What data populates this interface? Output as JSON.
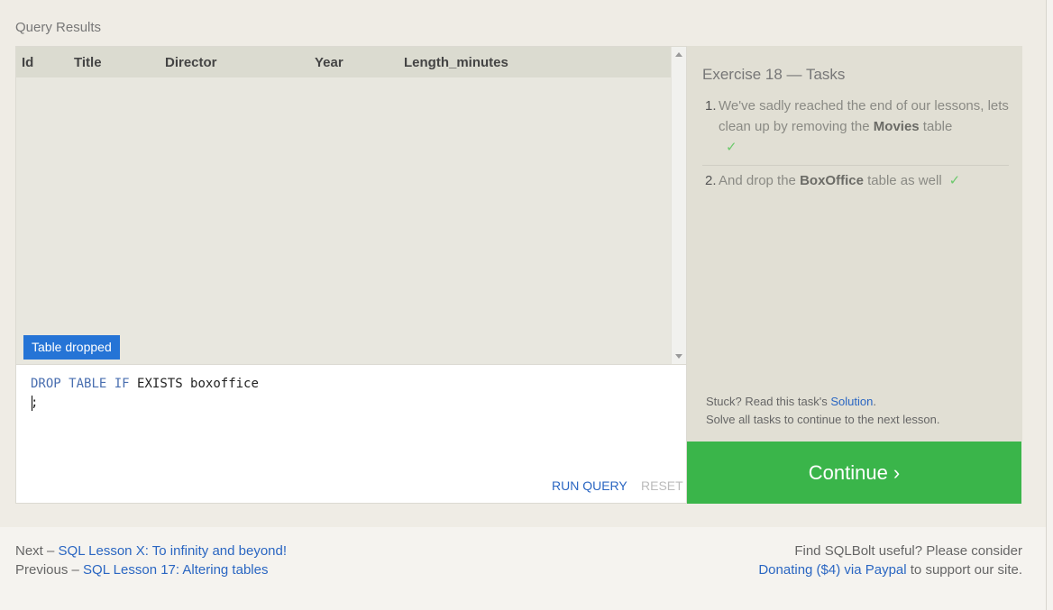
{
  "query_results": {
    "title": "Query Results",
    "columns": [
      "Id",
      "Title",
      "Director",
      "Year",
      "Length_minutes"
    ],
    "status": "Table dropped"
  },
  "editor": {
    "line1_kw1": "DROP",
    "line1_kw2": "TABLE",
    "line1_kw3": "IF",
    "line1_rest": "EXISTS boxoffice",
    "line2": ";",
    "run_label": "RUN QUERY",
    "reset_label": "RESET"
  },
  "tasks": {
    "title": "Exercise 18 — Tasks",
    "items": [
      {
        "num": "1.",
        "before": "We've sadly reached the end of our lessons, lets clean up by removing the ",
        "bold": "Movies",
        "after": " table",
        "check": "✓"
      },
      {
        "num": "2.",
        "before": "And drop the ",
        "bold": "BoxOffice",
        "after": " table as well",
        "check": "✓"
      }
    ],
    "stuck_prefix": "Stuck? Read this task's ",
    "stuck_link": "Solution",
    "stuck_suffix": ".",
    "solve_text": "Solve all tasks to continue to the next lesson.",
    "continue_label": "Continue ›"
  },
  "footer": {
    "next_prefix": "Next – ",
    "next_link": "SQL Lesson X: To infinity and beyond!",
    "prev_prefix": "Previous – ",
    "prev_link": "SQL Lesson 17: Altering tables",
    "right_line1": "Find SQLBolt useful? Please consider",
    "donate_link": "Donating ($4) via Paypal",
    "donate_suffix": " to support our site."
  }
}
